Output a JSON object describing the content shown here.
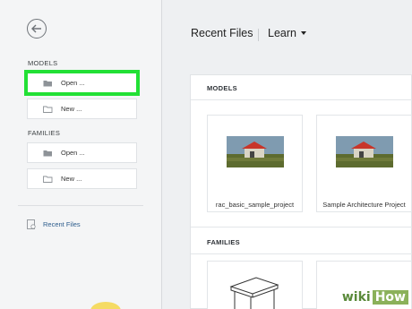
{
  "sidebar": {
    "models_label": "MODELS",
    "families_label": "FAMILIES",
    "models_open": "Open ...",
    "models_new": "New ...",
    "families_open": "Open ...",
    "families_new": "New ...",
    "recent_files": "Recent Files"
  },
  "header": {
    "title": "Recent Files",
    "learn": "Learn"
  },
  "panel": {
    "models_label": "MODELS",
    "families_label": "FAMILIES",
    "models": [
      {
        "label": "rac_basic_sample_project"
      },
      {
        "label": "Sample Architecture Project"
      }
    ]
  },
  "watermark": {
    "part1": "wiki",
    "part2": "How"
  },
  "colors": {
    "highlight": "#22e035",
    "accent_link": "#2c5c8c"
  }
}
